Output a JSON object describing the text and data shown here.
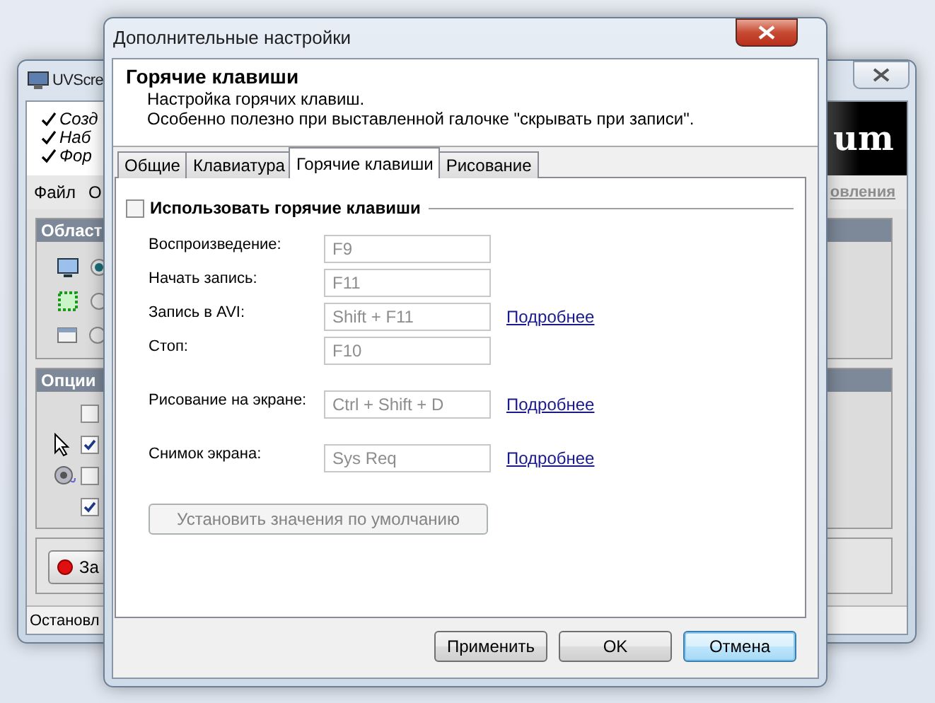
{
  "background_window": {
    "title": "UVScre",
    "checklist": [
      {
        "label": "Созд"
      },
      {
        "label": "Наб"
      },
      {
        "label": "Фор"
      }
    ],
    "menu": [
      "Файл",
      "О"
    ],
    "banner_text": "um",
    "update_link": "овления",
    "area_group": {
      "title": "Област",
      "options": [
        {
          "selected": true
        },
        {
          "selected": false
        },
        {
          "selected": false
        }
      ]
    },
    "options_group": {
      "title": "Опции",
      "checkboxes": [
        {
          "checked": false
        },
        {
          "checked": true
        },
        {
          "checked": false
        },
        {
          "checked": true
        }
      ]
    },
    "record_button": "За",
    "status": "Остановл"
  },
  "dialog": {
    "title": "Дополнительные настройки",
    "header": {
      "title": "Горячие клавиши",
      "lines": [
        "Настройка горячих клавиш.",
        "Особенно полезно при выставленной галочке \"скрывать при записи\"."
      ]
    },
    "tabs": [
      {
        "label": "Общие",
        "selected": false
      },
      {
        "label": "Клавиатура",
        "selected": false
      },
      {
        "label": "Горячие клавиши",
        "selected": true
      },
      {
        "label": "Рисование",
        "selected": false
      }
    ],
    "use_hotkeys": {
      "label": "Использовать горячие клавиши",
      "checked": false
    },
    "sections": [
      [
        {
          "label": "Воспроизведение:",
          "value": "F9",
          "disabled": true
        },
        {
          "label": "Начать запись:",
          "value": "F11",
          "disabled": true
        },
        {
          "label": "Запись в AVI:",
          "value": "Shift + F11",
          "disabled": true,
          "link": "Подробнее"
        },
        {
          "label": "Стоп:",
          "value": "F10",
          "disabled": true
        }
      ],
      [
        {
          "label": "Рисование на экране:",
          "value": "Ctrl + Shift + D",
          "disabled": true,
          "link": "Подробнее"
        }
      ],
      [
        {
          "label": "Снимок экрана:",
          "value": "Sys Req",
          "disabled": true,
          "link": "Подробнее"
        }
      ]
    ],
    "defaults_button": {
      "label": "Установить значения по умолчанию",
      "disabled": true
    },
    "buttons": [
      {
        "label": "Применить",
        "default": false
      },
      {
        "label": "OK",
        "default": false
      },
      {
        "label": "Отмена",
        "default": true
      }
    ]
  }
}
